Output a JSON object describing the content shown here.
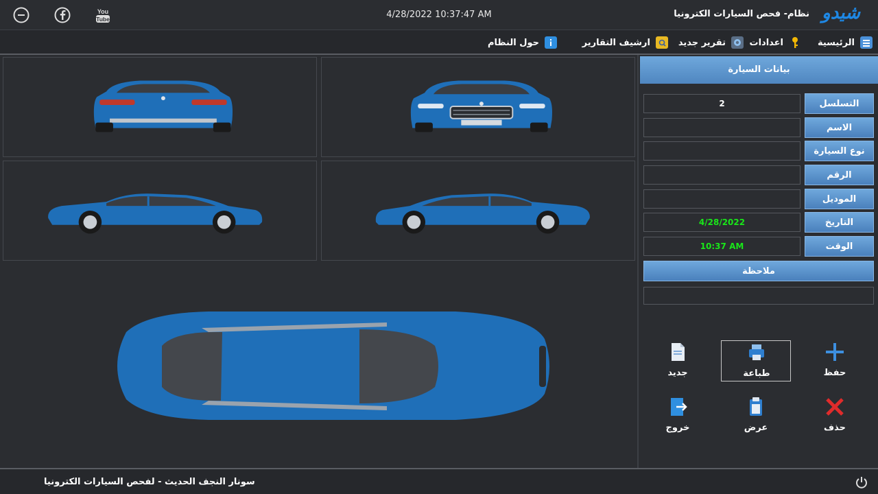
{
  "titlebar": {
    "datetime": "4/28/2022 10:37:47 AM",
    "app_title": "نظام- فحص السيارات الكترونيا",
    "brand": "شيدو",
    "icons": [
      "minimize-icon",
      "facebook-icon",
      "youtube-icon"
    ]
  },
  "menu": {
    "home": "الرئيسية",
    "settings": "اعدادات",
    "new_report": "تقرير جديد",
    "reports_archive": "ارشيف التقارير",
    "about": "حول النظام"
  },
  "side": {
    "header": "بيانات السيارة",
    "fields": [
      {
        "label": "التسلسل",
        "value": "2"
      },
      {
        "label": "الاسم",
        "value": ""
      },
      {
        "label": "نوع السيارة",
        "value": ""
      },
      {
        "label": "الرقم",
        "value": ""
      },
      {
        "label": "الموديل",
        "value": ""
      },
      {
        "label": "التاريخ",
        "value": "4/28/2022"
      },
      {
        "label": "الوقت",
        "value": "10:37 AM"
      }
    ],
    "note_label": "ملاحظة",
    "note_value": ""
  },
  "actions": {
    "save": "حفظ",
    "print": "طباعة",
    "new": "جديد",
    "delete": "حذف",
    "view": "عرض",
    "exit": "خروج"
  },
  "status": {
    "text": "سونار النجف الحديث - لفحص السيارات الكترونيا"
  },
  "colors": {
    "car_blue": "#1f6fb8",
    "accent": "#4f86c0",
    "date_green": "#19e619"
  }
}
